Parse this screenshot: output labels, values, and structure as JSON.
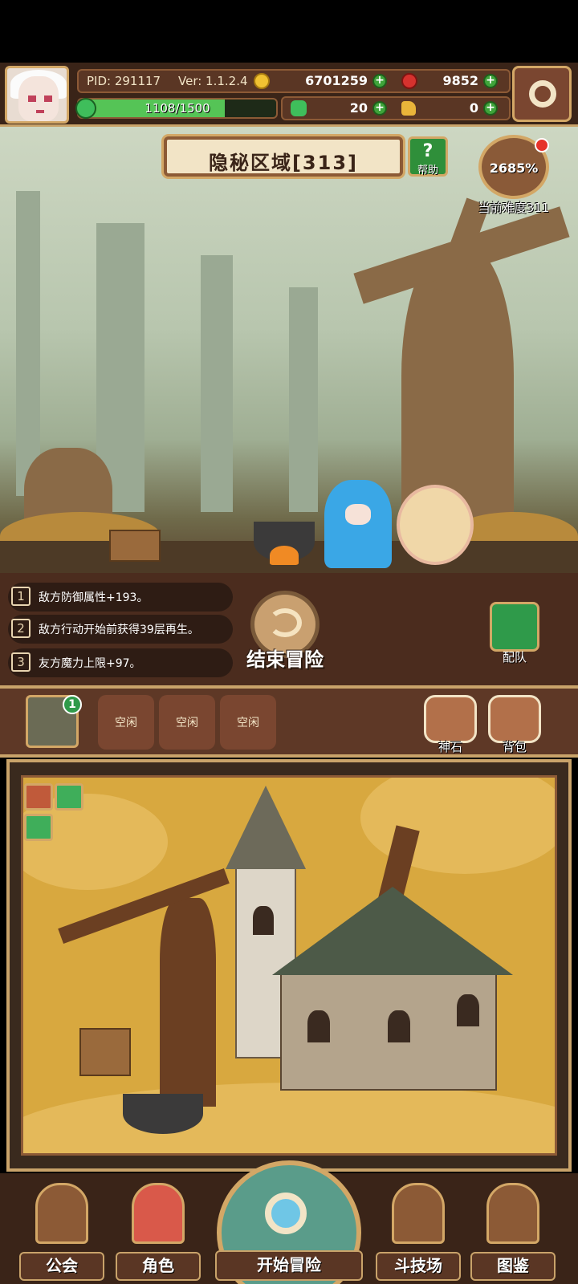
{
  "hud": {
    "pid": "PID: 291117",
    "version": "Ver: 1.1.2.4",
    "gold": "6701259",
    "rubies": "9852",
    "xp_text": "1108/1500",
    "xp_fraction": 0.739,
    "clovers": "20",
    "keys": "0"
  },
  "zone": {
    "name": "隐秘区域[313]",
    "help_label": "帮助",
    "difficulty_percent": "2685%",
    "difficulty_label": "当前难度311"
  },
  "buffs": [
    {
      "num": "1",
      "text": "敌方防御属性+193。"
    },
    {
      "num": "2",
      "text": "敌方行动开始前获得39层再生。"
    },
    {
      "num": "3",
      "text": "友方魔力上限+97。"
    }
  ],
  "actions": {
    "end_adventure": "结束冒险",
    "team": "配队"
  },
  "slots": {
    "badge": "1",
    "items": [
      "空闲",
      "空闲",
      "空闲"
    ],
    "divine_stone": "神石",
    "backpack": "背包"
  },
  "nav": {
    "guild": "公会",
    "character": "角色",
    "start_adventure": "开始冒险",
    "arena": "斗技场",
    "codex": "图鉴"
  },
  "icons": [
    "avatar",
    "gold-coin-icon",
    "ruby-icon",
    "clover-icon",
    "key-icon",
    "settings-gear-icon",
    "help-icon",
    "difficulty-icon",
    "end-adventure-icon",
    "team-icon",
    "divine-stone-icon",
    "backpack-icon",
    "guild-icon",
    "character-icon",
    "magnifier-icon",
    "arena-swords-icon",
    "codex-book-icon"
  ]
}
